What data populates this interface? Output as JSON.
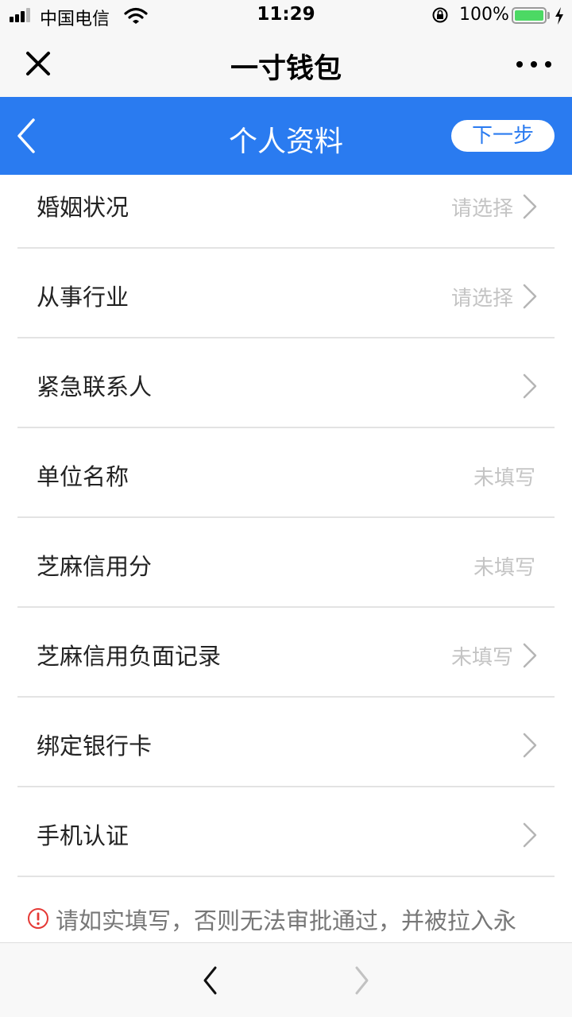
{
  "status_bar": {
    "carrier": "中国电信",
    "time": "11:29",
    "battery_percent": "100%",
    "battery_level": 1.0
  },
  "title_bar": {
    "title": "一寸钱包",
    "close_icon": "close-icon",
    "more_icon": "more-dots-icon"
  },
  "nav": {
    "title": "个人资料",
    "next_label": "下一步",
    "back_icon": "chevron-left-icon",
    "accent_color": "#2a7bf0"
  },
  "rows": [
    {
      "label": "婚姻状况",
      "value": "请选择",
      "arrow": true
    },
    {
      "label": "从事行业",
      "value": "请选择",
      "arrow": true
    },
    {
      "label": "紧急联系人",
      "value": "",
      "arrow": true
    },
    {
      "label": "单位名称",
      "value": "未填写",
      "arrow": false
    },
    {
      "label": "芝麻信用分",
      "value": "未填写",
      "arrow": false
    },
    {
      "label": "芝麻信用负面记录",
      "value": "未填写",
      "arrow": true
    },
    {
      "label": "绑定银行卡",
      "value": "",
      "arrow": true
    },
    {
      "label": "手机认证",
      "value": "",
      "arrow": true
    }
  ],
  "notice": {
    "text": "请如实填写，否则无法审批通过，并被拉入永",
    "icon": "warning-circle-icon",
    "icon_color": "#e53935"
  },
  "bottom_bar": {
    "back_icon": "chevron-left-icon",
    "forward_icon": "chevron-right-icon"
  }
}
